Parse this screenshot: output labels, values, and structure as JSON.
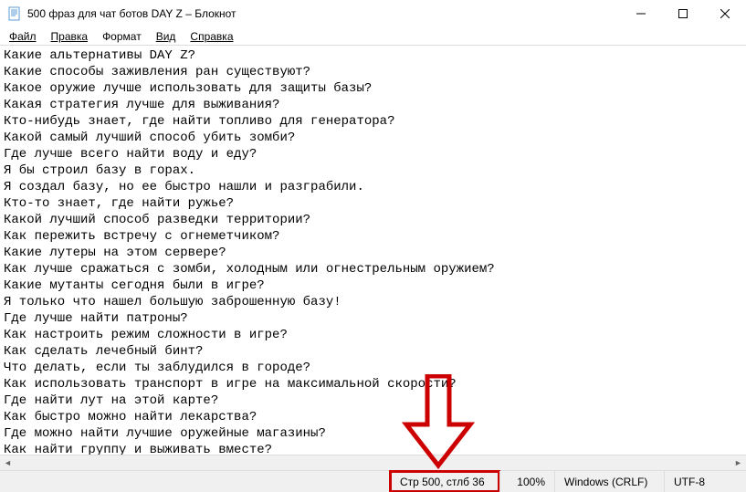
{
  "window": {
    "title": "500 фраз для чат ботов DAY Z – Блокнот"
  },
  "menu": {
    "file": "Файл",
    "edit": "Правка",
    "format": "Формат",
    "view": "Вид",
    "help": "Справка"
  },
  "lines": [
    "Какие альтернативы DAY Z?",
    "Какие способы заживления ран существуют?",
    "Какое оружие лучше использовать для защиты базы?",
    "Какая стратегия лучше для выживания?",
    "Кто-нибудь знает, где найти топливо для генератора?",
    "Какой самый лучший способ убить зомби?",
    "Где лучше всего найти воду и еду?",
    "Я бы строил базу в горах.",
    "Я создал базу, но ее быстро нашли и разграбили.",
    "Кто-то знает, где найти ружье?",
    "Какой лучший способ разведки территории?",
    "Как пережить встречу с огнеметчиком?",
    "Какие лутеры на этом сервере?",
    "Как лучше сражаться с зомби, холодным или огнестрельным оружием?",
    "Какие мутанты сегодня были в игре?",
    "Я только что нашел большую заброшенную базу!",
    "Где лучше найти патроны?",
    "Как настроить режим сложности в игре?",
    "Как сделать лечебный бинт?",
    "Что делать, если ты заблудился в городе?",
    "Как использовать транспорт в игре на максимальной скорости?",
    "Где найти лут на этой карте?",
    "Как быстро можно найти лекарства?",
    "Где можно найти лучшие оружейные магазины?",
    "Как найти группу и выживать вместе?"
  ],
  "status": {
    "cursor": "Стр 500, стлб 36",
    "zoom": "100%",
    "line_endings": "Windows (CRLF)",
    "encoding": "UTF-8"
  }
}
